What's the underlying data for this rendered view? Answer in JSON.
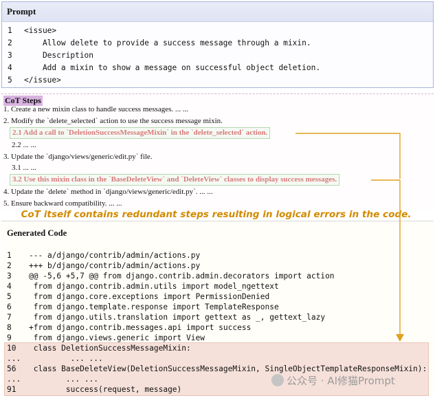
{
  "prompt": {
    "title": "Prompt",
    "lines": [
      {
        "num": "1",
        "text": "<issue>"
      },
      {
        "num": "2",
        "text": "    Allow delete to provide a success message through a mixin."
      },
      {
        "num": "3",
        "text": "    Description"
      },
      {
        "num": "4",
        "text": "    Add a mixin to show a message on successful object deletion."
      },
      {
        "num": "5",
        "text": "</issue>"
      }
    ]
  },
  "cot": {
    "title": "CoT Steps",
    "steps": [
      "1. Create a new mixin class to handle success messages. ... ...",
      "2. Modify the `delete_selected` action to use the success message mixin.",
      "2.1 Add a call to `DeletionSuccessMessageMixin` in the `delete_selected` action.",
      "2.2 ... ...",
      "3. Update the `django/views/generic/edit.py` file.",
      "3.1 ... ...",
      "3.2 Use this mixin class in the `BaseDeleteView` and `DeleteView` classes to display success messages.",
      "4. Update the `delete` method in `django/views/generic/edit.py`. ... ...",
      "5. Ensure backward compatibility. ... ..."
    ]
  },
  "caption": "CoT itself contains redundant steps resulting in logical errors in the code.",
  "generated": {
    "title": "Generated Code",
    "lines": [
      {
        "num": "1",
        "text": "--- a/django/contrib/admin/actions.py"
      },
      {
        "num": "2",
        "text": "+++ b/django/contrib/admin/actions.py"
      },
      {
        "num": "3",
        "text": "@@ -5,6 +5,7 @@ from django.contrib.admin.decorators import action"
      },
      {
        "num": "4",
        "text": " from django.contrib.admin.utils import model_ngettext"
      },
      {
        "num": "5",
        "text": " from django.core.exceptions import PermissionDenied"
      },
      {
        "num": "6",
        "text": " from django.template.response import TemplateResponse"
      },
      {
        "num": "7",
        "text": " from django.utils.translation import gettext as _, gettext_lazy"
      },
      {
        "num": "8",
        "text": "+from django.contrib.messages.api import success"
      },
      {
        "num": "9",
        "text": " from django.views.generic import View"
      },
      {
        "num": "10",
        "text": " class DeletionSuccessMessageMixin:"
      },
      {
        "num": "...",
        "text": "         ... ..."
      },
      {
        "num": "56",
        "text": " class BaseDeleteView(DeletionSuccessMessageMixin, SingleObjectTemplateResponseMixin):"
      },
      {
        "num": "...",
        "text": "        ... ..."
      },
      {
        "num": "91",
        "text": "        success(request, message)"
      }
    ]
  },
  "watermark": "公众号 · AI修猫Prompt",
  "colors": {
    "caption": "#d28a00",
    "connector": "#e0a020",
    "highlight_text": "#d87a7a",
    "highlight_border": "#b5d6b2",
    "code_highlight_bg": "#f6e1da"
  }
}
